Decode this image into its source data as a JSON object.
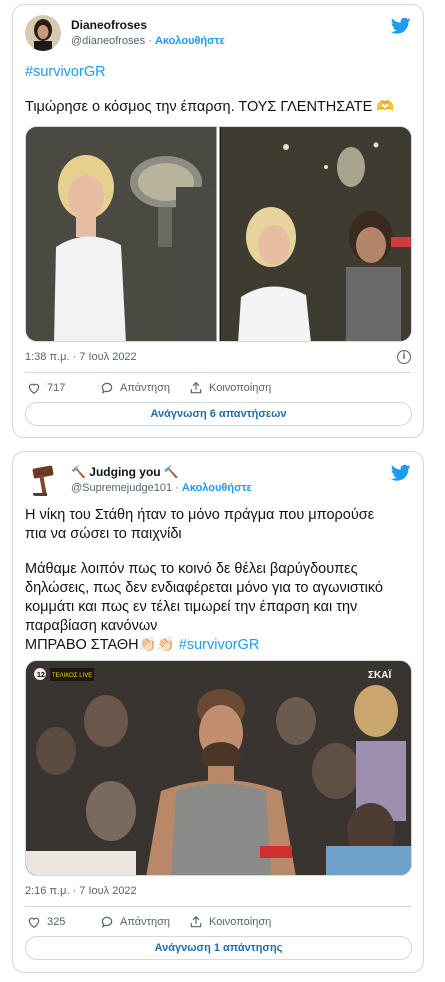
{
  "tweets": [
    {
      "name": "Dianeofroses",
      "handle": "@dianeofroses",
      "follow": "Ακολουθήστε",
      "hashtag": "#survivorGR",
      "text": "Τιμώρησε ο κόσμος την έπαρση. ΤΟΥΣ ΓΛΕΝΤΗΣΑΤΕ 🫶",
      "timestamp": "1:38 π.μ. · 7 Ιουλ 2022",
      "likes": "717",
      "reply_label": "Απάντηση",
      "share_label": "Κοινοποίηση",
      "replies_button": "Ανάγνωση 6 απαντήσεων"
    },
    {
      "name": "🔨 Judging you 🔨",
      "handle": "@Supremejudge101",
      "follow": "Ακολουθήστε",
      "text_line1": "Η νίκη του Στάθη ήταν το μόνο πράγμα που μπορούσε",
      "text_line2": "πια να σώσει το παιχνίδι",
      "text_line3": "Μάθαμε λοιπόν πως το κοινό δε θέλει βαρύγδουπες",
      "text_line4": "δηλώσεις, πως δεν ενδιαφέρεται μόνο για το αγωνιστικό",
      "text_line5": "κομμάτι και πως εν τέλει τιμωρεί την έπαρση και την",
      "text_line6": "παραβίαση κανόνων",
      "text_line7": "ΜΠΡΑΒΟ ΣΤΑΘΗ👏🏻👏🏻",
      "hashtag": "#survivorGR",
      "video_overlay_left": "ΤΕΛΙΚΟΣ LIVE #survivorGR",
      "video_overlay_channel": "12",
      "video_overlay_right": "ΣΚΑΪ",
      "timestamp": "2:16 π.μ. · 7 Ιουλ 2022",
      "likes": "325",
      "reply_label": "Απάντηση",
      "share_label": "Κοινοποίηση",
      "replies_button": "Ανάγνωση 1 απάντησης"
    }
  ],
  "colors": {
    "twitter_blue": "#1d9bf0",
    "text": "#0f1419",
    "muted": "#536471",
    "border": "#cfd9de"
  }
}
